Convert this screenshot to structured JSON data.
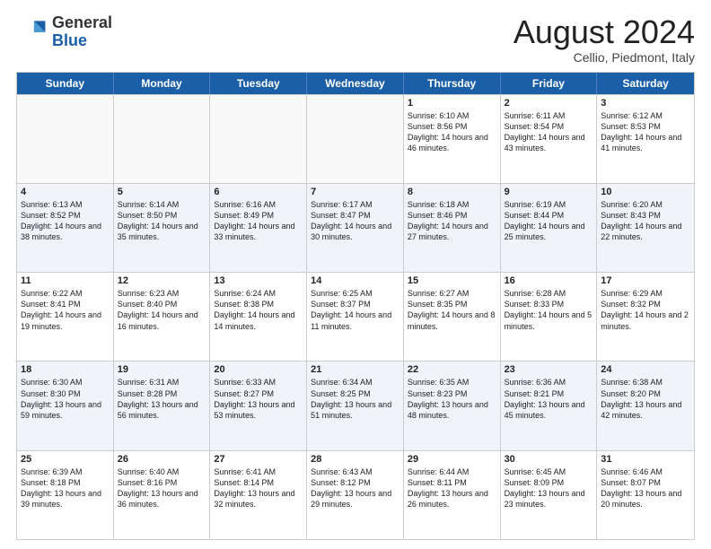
{
  "logo": {
    "general": "General",
    "blue": "Blue"
  },
  "title": {
    "month_year": "August 2024",
    "location": "Cellio, Piedmont, Italy"
  },
  "weekdays": [
    "Sunday",
    "Monday",
    "Tuesday",
    "Wednesday",
    "Thursday",
    "Friday",
    "Saturday"
  ],
  "weeks": [
    [
      {
        "day": "",
        "sunrise": "",
        "sunset": "",
        "daylight": ""
      },
      {
        "day": "",
        "sunrise": "",
        "sunset": "",
        "daylight": ""
      },
      {
        "day": "",
        "sunrise": "",
        "sunset": "",
        "daylight": ""
      },
      {
        "day": "",
        "sunrise": "",
        "sunset": "",
        "daylight": ""
      },
      {
        "day": "1",
        "sunrise": "Sunrise: 6:10 AM",
        "sunset": "Sunset: 8:56 PM",
        "daylight": "Daylight: 14 hours and 46 minutes."
      },
      {
        "day": "2",
        "sunrise": "Sunrise: 6:11 AM",
        "sunset": "Sunset: 8:54 PM",
        "daylight": "Daylight: 14 hours and 43 minutes."
      },
      {
        "day": "3",
        "sunrise": "Sunrise: 6:12 AM",
        "sunset": "Sunset: 8:53 PM",
        "daylight": "Daylight: 14 hours and 41 minutes."
      }
    ],
    [
      {
        "day": "4",
        "sunrise": "Sunrise: 6:13 AM",
        "sunset": "Sunset: 8:52 PM",
        "daylight": "Daylight: 14 hours and 38 minutes."
      },
      {
        "day": "5",
        "sunrise": "Sunrise: 6:14 AM",
        "sunset": "Sunset: 8:50 PM",
        "daylight": "Daylight: 14 hours and 35 minutes."
      },
      {
        "day": "6",
        "sunrise": "Sunrise: 6:16 AM",
        "sunset": "Sunset: 8:49 PM",
        "daylight": "Daylight: 14 hours and 33 minutes."
      },
      {
        "day": "7",
        "sunrise": "Sunrise: 6:17 AM",
        "sunset": "Sunset: 8:47 PM",
        "daylight": "Daylight: 14 hours and 30 minutes."
      },
      {
        "day": "8",
        "sunrise": "Sunrise: 6:18 AM",
        "sunset": "Sunset: 8:46 PM",
        "daylight": "Daylight: 14 hours and 27 minutes."
      },
      {
        "day": "9",
        "sunrise": "Sunrise: 6:19 AM",
        "sunset": "Sunset: 8:44 PM",
        "daylight": "Daylight: 14 hours and 25 minutes."
      },
      {
        "day": "10",
        "sunrise": "Sunrise: 6:20 AM",
        "sunset": "Sunset: 8:43 PM",
        "daylight": "Daylight: 14 hours and 22 minutes."
      }
    ],
    [
      {
        "day": "11",
        "sunrise": "Sunrise: 6:22 AM",
        "sunset": "Sunset: 8:41 PM",
        "daylight": "Daylight: 14 hours and 19 minutes."
      },
      {
        "day": "12",
        "sunrise": "Sunrise: 6:23 AM",
        "sunset": "Sunset: 8:40 PM",
        "daylight": "Daylight: 14 hours and 16 minutes."
      },
      {
        "day": "13",
        "sunrise": "Sunrise: 6:24 AM",
        "sunset": "Sunset: 8:38 PM",
        "daylight": "Daylight: 14 hours and 14 minutes."
      },
      {
        "day": "14",
        "sunrise": "Sunrise: 6:25 AM",
        "sunset": "Sunset: 8:37 PM",
        "daylight": "Daylight: 14 hours and 11 minutes."
      },
      {
        "day": "15",
        "sunrise": "Sunrise: 6:27 AM",
        "sunset": "Sunset: 8:35 PM",
        "daylight": "Daylight: 14 hours and 8 minutes."
      },
      {
        "day": "16",
        "sunrise": "Sunrise: 6:28 AM",
        "sunset": "Sunset: 8:33 PM",
        "daylight": "Daylight: 14 hours and 5 minutes."
      },
      {
        "day": "17",
        "sunrise": "Sunrise: 6:29 AM",
        "sunset": "Sunset: 8:32 PM",
        "daylight": "Daylight: 14 hours and 2 minutes."
      }
    ],
    [
      {
        "day": "18",
        "sunrise": "Sunrise: 6:30 AM",
        "sunset": "Sunset: 8:30 PM",
        "daylight": "Daylight: 13 hours and 59 minutes."
      },
      {
        "day": "19",
        "sunrise": "Sunrise: 6:31 AM",
        "sunset": "Sunset: 8:28 PM",
        "daylight": "Daylight: 13 hours and 56 minutes."
      },
      {
        "day": "20",
        "sunrise": "Sunrise: 6:33 AM",
        "sunset": "Sunset: 8:27 PM",
        "daylight": "Daylight: 13 hours and 53 minutes."
      },
      {
        "day": "21",
        "sunrise": "Sunrise: 6:34 AM",
        "sunset": "Sunset: 8:25 PM",
        "daylight": "Daylight: 13 hours and 51 minutes."
      },
      {
        "day": "22",
        "sunrise": "Sunrise: 6:35 AM",
        "sunset": "Sunset: 8:23 PM",
        "daylight": "Daylight: 13 hours and 48 minutes."
      },
      {
        "day": "23",
        "sunrise": "Sunrise: 6:36 AM",
        "sunset": "Sunset: 8:21 PM",
        "daylight": "Daylight: 13 hours and 45 minutes."
      },
      {
        "day": "24",
        "sunrise": "Sunrise: 6:38 AM",
        "sunset": "Sunset: 8:20 PM",
        "daylight": "Daylight: 13 hours and 42 minutes."
      }
    ],
    [
      {
        "day": "25",
        "sunrise": "Sunrise: 6:39 AM",
        "sunset": "Sunset: 8:18 PM",
        "daylight": "Daylight: 13 hours and 39 minutes."
      },
      {
        "day": "26",
        "sunrise": "Sunrise: 6:40 AM",
        "sunset": "Sunset: 8:16 PM",
        "daylight": "Daylight: 13 hours and 36 minutes."
      },
      {
        "day": "27",
        "sunrise": "Sunrise: 6:41 AM",
        "sunset": "Sunset: 8:14 PM",
        "daylight": "Daylight: 13 hours and 32 minutes."
      },
      {
        "day": "28",
        "sunrise": "Sunrise: 6:43 AM",
        "sunset": "Sunset: 8:12 PM",
        "daylight": "Daylight: 13 hours and 29 minutes."
      },
      {
        "day": "29",
        "sunrise": "Sunrise: 6:44 AM",
        "sunset": "Sunset: 8:11 PM",
        "daylight": "Daylight: 13 hours and 26 minutes."
      },
      {
        "day": "30",
        "sunrise": "Sunrise: 6:45 AM",
        "sunset": "Sunset: 8:09 PM",
        "daylight": "Daylight: 13 hours and 23 minutes."
      },
      {
        "day": "31",
        "sunrise": "Sunrise: 6:46 AM",
        "sunset": "Sunset: 8:07 PM",
        "daylight": "Daylight: 13 hours and 20 minutes."
      }
    ]
  ],
  "alt_weeks": [
    1,
    3
  ]
}
